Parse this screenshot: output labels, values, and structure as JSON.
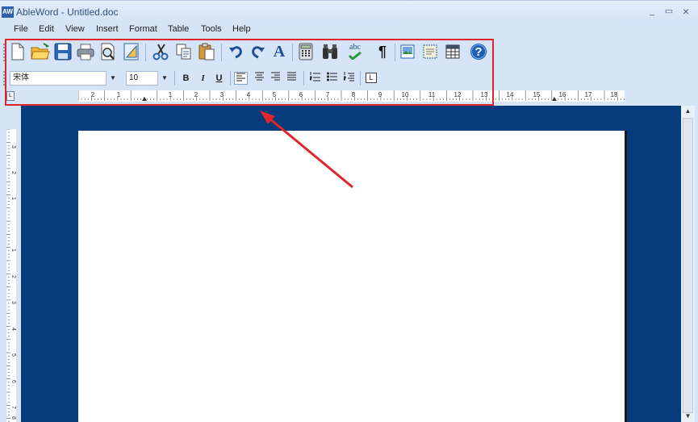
{
  "window": {
    "logo_text": "AW",
    "title": "AbleWord - Untitled.doc",
    "minimize": "_",
    "maximize": "▭",
    "close": "×"
  },
  "menu": [
    {
      "label": "File"
    },
    {
      "label": "Edit"
    },
    {
      "label": "View"
    },
    {
      "label": "Insert"
    },
    {
      "label": "Format"
    },
    {
      "label": "Table"
    },
    {
      "label": "Tools"
    },
    {
      "label": "Help"
    }
  ],
  "toolbar": {
    "buttons": [
      {
        "icon": "new-document-icon"
      },
      {
        "icon": "open-folder-icon"
      },
      {
        "icon": "save-icon"
      },
      {
        "icon": "print-icon"
      },
      {
        "icon": "print-preview-icon"
      },
      {
        "icon": "page-setup-icon"
      },
      {
        "icon": "cut-icon"
      },
      {
        "icon": "copy-icon"
      },
      {
        "icon": "paste-icon"
      },
      {
        "icon": "undo-icon"
      },
      {
        "icon": "redo-icon"
      },
      {
        "icon": "font-icon"
      },
      {
        "icon": "calculator-icon"
      },
      {
        "icon": "find-icon"
      },
      {
        "icon": "spell-check-icon"
      },
      {
        "icon": "paragraph-mark-icon"
      },
      {
        "icon": "insert-image-icon"
      },
      {
        "icon": "text-frame-icon"
      },
      {
        "icon": "insert-table-icon"
      },
      {
        "icon": "help-icon"
      }
    ],
    "spell_label": "abc",
    "font_letter": "A",
    "pilcrow": "¶",
    "help_mark": "?"
  },
  "format_bar": {
    "font_name": "宋体",
    "font_size": "10",
    "dropdown_arrow": "▼",
    "bold": "B",
    "italic": "I",
    "underline": "U",
    "align_left": "≡",
    "align_center": "≡",
    "align_right": "≡",
    "justify": "≡",
    "numbered_list": "☰",
    "bullet_list": "☰",
    "indent_list": "☰",
    "tab_stop": "L"
  },
  "ruler": {
    "corner": "L",
    "h_numbers": [
      "2",
      "1",
      "1",
      "2",
      "3",
      "4",
      "5",
      "6",
      "7",
      "8",
      "9",
      "10",
      "11",
      "12",
      "13",
      "14",
      "15",
      "16",
      "17",
      "18"
    ],
    "v_numbers": [
      "3",
      "2",
      "1",
      "1",
      "2",
      "3",
      "4",
      "5",
      "6",
      "7",
      "8"
    ]
  },
  "scrollbar": {
    "up": "▲",
    "down": "▼"
  },
  "colors": {
    "accent_annotation": "#e0262a",
    "workspace": "#063b7c",
    "chrome": "#d6e4f7"
  }
}
